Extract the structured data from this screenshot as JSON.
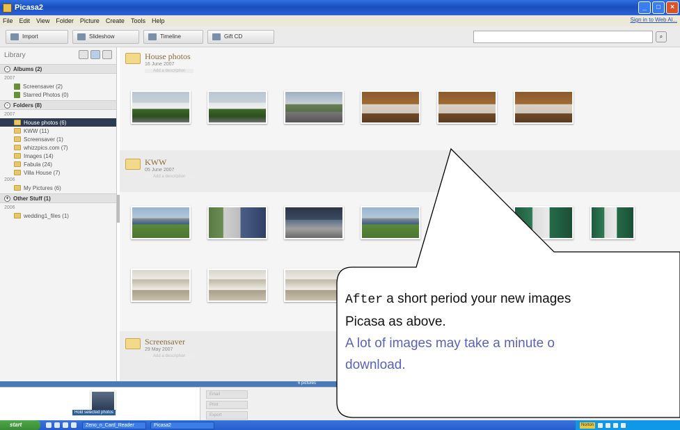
{
  "window": {
    "title": "Picasa2",
    "controls": [
      "_",
      "□",
      "×"
    ]
  },
  "menu": {
    "items": [
      "File",
      "Edit",
      "View",
      "Folder",
      "Picture",
      "Create",
      "Tools",
      "Help"
    ],
    "signin": "Sign in to Web Al..."
  },
  "toolbar": {
    "buttons": [
      {
        "label": "Import",
        "icon": "import-icon"
      },
      {
        "label": "Slideshow",
        "icon": "play-icon"
      },
      {
        "label": "Timeline",
        "icon": "timeline-icon"
      },
      {
        "label": "Gift CD",
        "icon": "cd-icon"
      }
    ],
    "search_placeholder": ""
  },
  "sidebar": {
    "title": "Library",
    "groups": [
      {
        "label": "Albums (2)",
        "toggle": "-",
        "years": [
          {
            "year": "2007",
            "items": [
              {
                "label": "Screensaver (2)",
                "kind": "album"
              },
              {
                "label": "Starred Photos (0)",
                "kind": "album"
              }
            ]
          }
        ]
      },
      {
        "label": "Folders (8)",
        "toggle": "-",
        "years": [
          {
            "year": "2007",
            "items": [
              {
                "label": "House photos (6)",
                "kind": "folder",
                "selected": true
              },
              {
                "label": "KWW (11)",
                "kind": "folder"
              },
              {
                "label": "Screensaver (1)",
                "kind": "folder"
              },
              {
                "label": "whizzpics.com (7)",
                "kind": "folder"
              },
              {
                "label": "Images (14)",
                "kind": "folder"
              },
              {
                "label": "Fabula (24)",
                "kind": "folder"
              },
              {
                "label": "Villa House (7)",
                "kind": "folder"
              }
            ]
          },
          {
            "year": "2006",
            "items": [
              {
                "label": "My Pictures (6)",
                "kind": "folder"
              }
            ]
          }
        ]
      },
      {
        "label": "Other Stuff (1)",
        "toggle": "+",
        "years": [
          {
            "year": "2006",
            "items": [
              {
                "label": "wedding1_files (1)",
                "kind": "folder"
              }
            ]
          }
        ]
      }
    ]
  },
  "main": {
    "folders": [
      {
        "title": "House photos",
        "date": "16 June 2007",
        "caption": "Add a description"
      },
      {
        "title": "KWW",
        "date": "05 June 2007",
        "caption": "Add a description"
      },
      {
        "title": "Screensaver",
        "date": "29 May 2007",
        "caption": "Add a description"
      }
    ]
  },
  "tray": {
    "status": "6 pictures",
    "hold_label": "Hold selected photos",
    "tools": [
      "Email",
      "Print",
      "Export"
    ]
  },
  "taskbar": {
    "start": "start",
    "tasks": [
      "Zeno_n_Card_Reader",
      "Picasa2"
    ],
    "norton": "Norton"
  },
  "callout": {
    "line1_mono": "After",
    "line1_rest": " a short period your new images",
    "line2": "Picasa as above.",
    "line3": "A lot of images may take a minute o",
    "line4": "download."
  }
}
